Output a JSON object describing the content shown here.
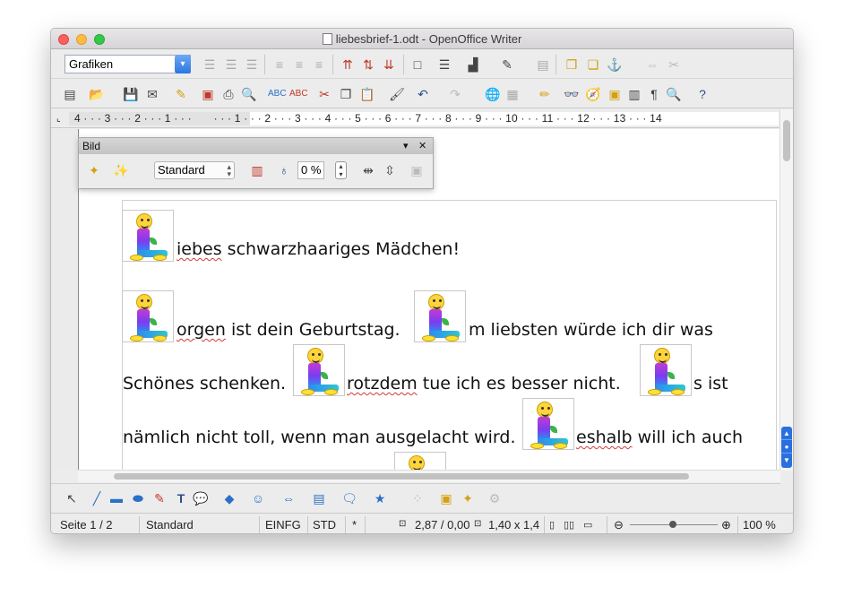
{
  "window": {
    "title": "liebesbrief-1.odt - OpenOffice Writer"
  },
  "formatting_toolbar": {
    "paragraph_style": "Grafiken"
  },
  "ruler": {
    "text": "4 · · · 3 · · · 2 · · · 1 · · ·       · · · 1 · · · 2 · · · 3 · · · 4 · · · 5 · · · 6 · · · 7 · · · 8 · · · 9 · · · 10 · · · 11 · · · 12 · · · 13 · · · 14"
  },
  "bild_toolbar": {
    "title": "Bild",
    "graphics_mode": "Standard",
    "transparency": "0 %"
  },
  "document": {
    "lines": [
      {
        "pre": "",
        "underlined": "iebes",
        "post": " schwarzhaariges Mädchen!"
      },
      {
        "part1_underlined": "orgen",
        "part1_rest": " ist dein Geburtstag.",
        "part2": "m liebsten würde ich dir was"
      },
      {
        "part1": "Schönes schenken.",
        "part2_underlined": "rotzdem",
        "part2_rest": " tue ich es besser nicht.",
        "part3": "s ist"
      },
      {
        "part1": "nämlich nicht toll, wenn man ausgelacht wird.",
        "part2_underlined": "eshalb",
        "part2_rest": " will ich auch"
      }
    ]
  },
  "statusbar": {
    "page": "Seite 1 / 2",
    "page_style": "Standard",
    "insert_mode": "EINFG",
    "selection_mode": "STD",
    "modified": "*",
    "position": "2,87 / 0,00",
    "size": "1,40 x 1,4",
    "zoom": "100 %"
  }
}
